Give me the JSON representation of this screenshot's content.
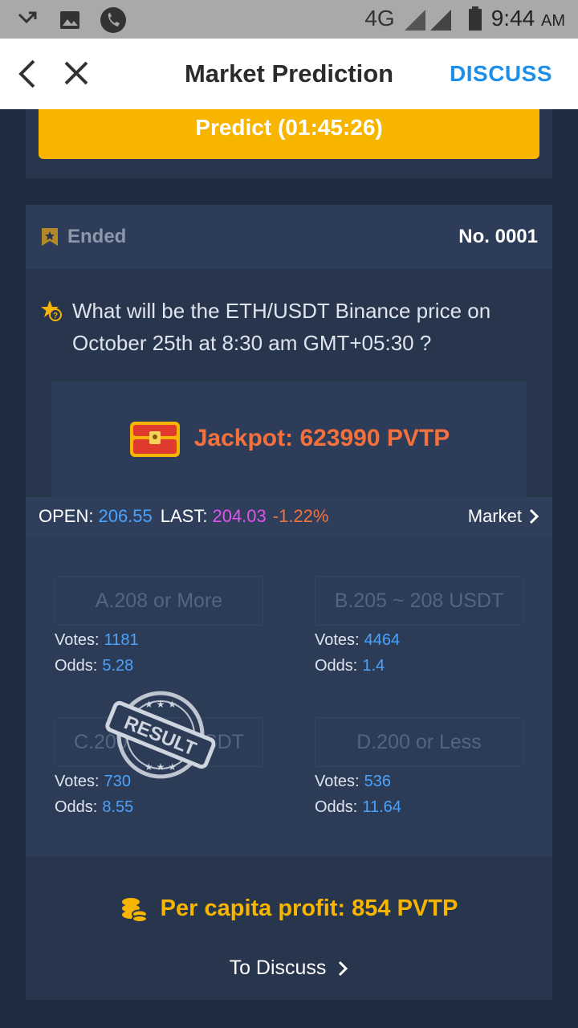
{
  "status_bar": {
    "network": "4G",
    "time": "9:44",
    "ampm": "AM"
  },
  "appbar": {
    "title": "Market Prediction",
    "discuss_label": "DISCUSS"
  },
  "predict_button": "Predict (01:45:26)",
  "round": {
    "status": "Ended",
    "number": "No. 0001",
    "question": "What will be the ETH/USDT Binance price on October 25th at 8:30 am GMT+05:30 ?",
    "jackpot": "Jackpot: 623990 PVTP"
  },
  "price": {
    "open_label": "OPEN:",
    "open_value": "206.55",
    "last_label": "LAST:",
    "last_value": "204.03",
    "change": "-1.22%",
    "market_label": "Market"
  },
  "options": [
    {
      "label": "A.208 or More",
      "votes_label": "Votes:",
      "votes": "1181",
      "odds_label": "Odds:",
      "odds": "5.28"
    },
    {
      "label": "B.205 ~ 208 USDT",
      "votes_label": "Votes:",
      "votes": "4464",
      "odds_label": "Odds:",
      "odds": "1.4"
    },
    {
      "label": "C.200 ~ 205 USDT",
      "votes_label": "Votes:",
      "votes": "730",
      "odds_label": "Odds:",
      "odds": "8.55"
    },
    {
      "label": "D.200 or Less",
      "votes_label": "Votes:",
      "votes": "536",
      "odds_label": "Odds:",
      "odds": "11.64"
    }
  ],
  "result_stamp": "RESULT",
  "profit": "Per capita profit: 854 PVTP",
  "to_discuss": "To Discuss",
  "colors": {
    "accent_blue": "#1d8fe8",
    "predict_yellow": "#f7b500",
    "jackpot_orange": "#f4703c",
    "value_blue": "#4aa3ff",
    "last_pink": "#e052f0"
  },
  "icons": {
    "status_left": [
      "missed-call-icon",
      "image-icon",
      "phone-icon"
    ],
    "status_right": [
      "signal-icon",
      "battery-icon"
    ],
    "appbar": [
      "back-arrow-icon",
      "close-icon"
    ],
    "ended": "flag-icon",
    "question": "star-question-icon",
    "jackpot": "treasure-chest-icon",
    "profit": "coins-icon",
    "chevron": "chevron-right-icon"
  }
}
